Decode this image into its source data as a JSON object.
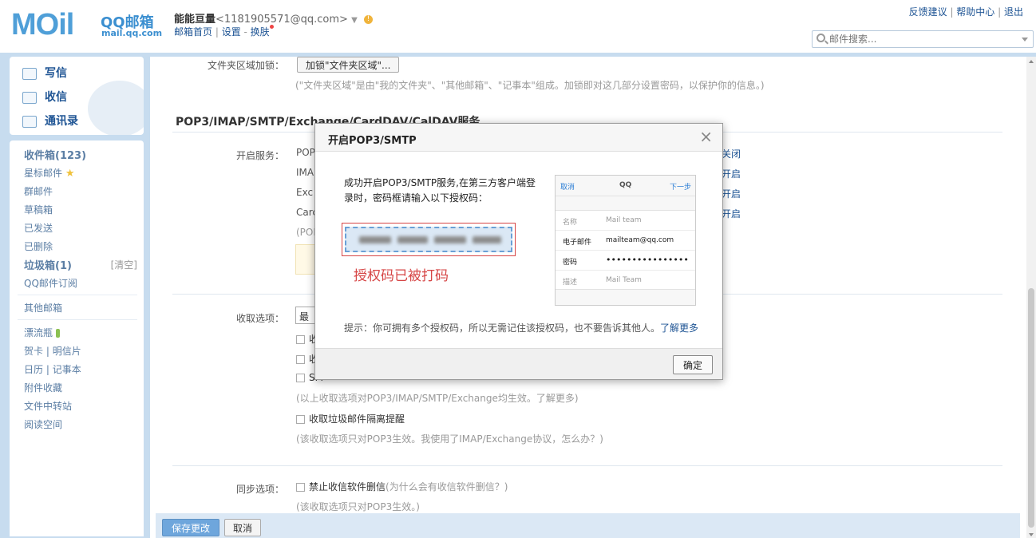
{
  "header": {
    "logo_text": "MOil",
    "logo_cn": "QQ邮箱",
    "logo_url": "mail.qq.com",
    "nickname": "能能亘量",
    "email": "<1181905571@qq.com>",
    "dropdown_arrow": "▼",
    "warn_icon": "!",
    "nav_home": "邮箱首页",
    "nav_settings": "设置",
    "nav_skin": "换肤",
    "top_feedback": "反馈建议",
    "top_help": "帮助中心",
    "top_logout": "退出",
    "search_placeholder": "邮件搜索..."
  },
  "sidebar_top": {
    "compose": "写信",
    "receive": "收信",
    "contacts": "通讯录"
  },
  "sidebar": {
    "inbox": "收件箱(123)",
    "starred": "星标邮件",
    "star_icon": "★",
    "group": "群邮件",
    "drafts": "草稿箱",
    "sent": "已发送",
    "deleted": "已删除",
    "spam": "垃圾箱(1)",
    "clear": "[清空]",
    "subscriptions": "QQ邮件订阅",
    "other_mailbox": "其他邮箱",
    "drift_bottle": "漂流瓶",
    "greeting_cards": "贺卡",
    "postcards": "明信片",
    "calendar": "日历",
    "notes": "记事本",
    "attachments": "附件收藏",
    "file_transfer": "文件中转站",
    "reading": "阅读空间",
    "sep": "|"
  },
  "settings": {
    "folder_lock_label": "文件夹区域加锁：",
    "folder_lock_btn": "加锁\"文件夹区域\"...",
    "folder_lock_desc": "(\"文件夹区域\"是由\"我的文件夹\"、\"其他邮箱\"、\"记事本\"组成。加锁即对这几部分设置密码，以保护你的信息。)",
    "section_title": "POP3/IMAP/SMTP/Exchange/CardDAV/CalDAV服务",
    "enable_label": "开启服务：",
    "svc_rows": [
      "POP",
      "IMA",
      "Exc",
      "Carc"
    ],
    "svc_pop_hint": "(POP",
    "svc_status": [
      "关闭",
      "开启",
      "开启",
      "开启"
    ],
    "recv_label": "收取选项：",
    "recv_select": "最",
    "recv_opt_1": "收",
    "recv_opt_2": "收",
    "recv_opt_3": "SM",
    "recv_effect": "(以上收取选项对POP3/IMAP/SMTP/Exchange均生效。了解更多)",
    "spam_reminder": "收取垃圾邮件隔离提醒",
    "pop3_only": "(该收取选项只对POP3生效。我使用了IMAP/Exchange协议，怎么办？)",
    "sync_label": "同步选项：",
    "sync_opt": "禁止收信软件删信",
    "sync_why": "(为什么会有收信软件删信？)",
    "sync_pop3": "(该收取选项只对POP3生效。)",
    "save": "保存更改",
    "cancel": "取消"
  },
  "dialog": {
    "title": "开启POP3/SMTP",
    "close": "×",
    "message": "成功开启POP3/SMTP服务,在第三方客户端登录时，密码框请输入以下授权码：",
    "redacted_note": "授权码已被打码",
    "hint": "提示：你可拥有多个授权码，所以无需记住该授权码，也不要告诉其他人。",
    "learn_more": "了解更多",
    "ok": "确定",
    "phone": {
      "cancel": "取消",
      "title": "QQ",
      "next": "下一步",
      "name_key": "名称",
      "name_val": "Mail team",
      "email_key": "电子邮件",
      "email_val": "mailteam@qq.com",
      "pwd_key": "密码",
      "pwd_val": "••••••••••••••••",
      "desc_key": "描述",
      "desc_val": "Mail Team"
    }
  }
}
